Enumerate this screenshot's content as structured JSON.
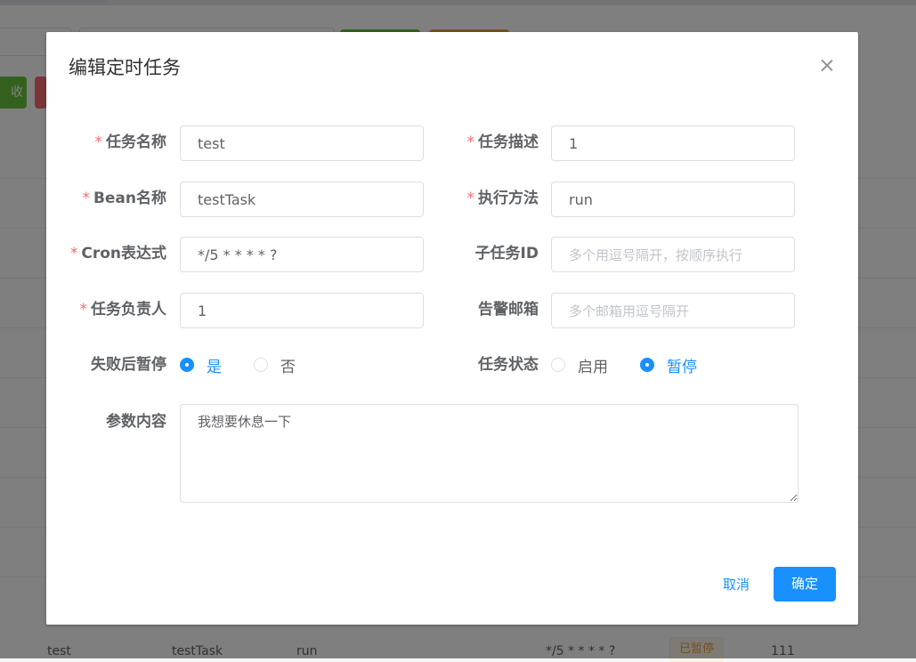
{
  "background": {
    "left_button_label": "收",
    "last_row": {
      "name": "test",
      "bean": "testTask",
      "method": "run",
      "cron": "*/5 * * * * ?",
      "status": "已暂停",
      "id": "111"
    }
  },
  "dialog": {
    "title": "编辑定时任务",
    "fields": {
      "task_name": {
        "label": "任务名称",
        "value": "test",
        "required": true
      },
      "task_desc": {
        "label": "任务描述",
        "value": "1",
        "required": true
      },
      "bean_name": {
        "label": "Bean名称",
        "value": "testTask",
        "required": true
      },
      "exec_method": {
        "label": "执行方法",
        "value": "run",
        "required": true
      },
      "cron": {
        "label": "Cron表达式",
        "value": "*/5 * * * * ?",
        "required": true
      },
      "sub_task_id": {
        "label": "子任务ID",
        "value": "",
        "placeholder": "多个用逗号隔开，按顺序执行"
      },
      "owner": {
        "label": "任务负责人",
        "value": "1",
        "required": true
      },
      "alarm_email": {
        "label": "告警邮箱",
        "value": "",
        "placeholder": "多个邮箱用逗号隔开"
      },
      "pause_after_fail": {
        "label": "失败后暂停",
        "options": [
          "是",
          "否"
        ],
        "selected": "是"
      },
      "task_status": {
        "label": "任务状态",
        "options": [
          "启用",
          "暂停"
        ],
        "selected": "暂停"
      },
      "params": {
        "label": "参数内容",
        "value": "我想要休息一下"
      }
    },
    "required_mark": "*",
    "cancel_label": "取消",
    "confirm_label": "确定"
  },
  "colors": {
    "primary": "#1890ff",
    "required": "#f56c6c",
    "label": "#606266",
    "placeholder": "#c0c4cc",
    "tag_warning": "#e6a23c"
  }
}
